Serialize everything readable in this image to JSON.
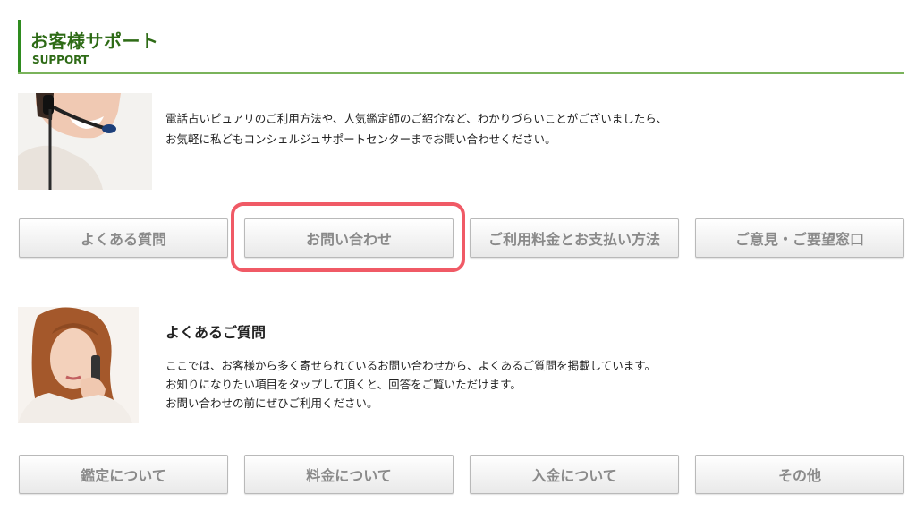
{
  "support": {
    "title": "お客様サポート",
    "subtitle": "SUPPORT",
    "intro_lines": [
      "電話占いピュアリのご利用方法や、人気鑑定師のご紹介など、わかりづらいことがございましたら、",
      "お気軽に私どもコンシェルジュサポートセンターまでお問い合わせください。"
    ],
    "buttons": [
      "よくある質問",
      "お問い合わせ",
      "ご利用料金とお支払い方法",
      "ご意見・ご要望窓口"
    ],
    "highlight_color": "#f05a66"
  },
  "faq": {
    "title": "よくあるご質問",
    "lines": [
      "ここでは、お客様から多く寄せられているお問い合わせから、よくあるご質問を掲載しています。",
      "お知りになりたい項目をタップして頂くと、回答をご覧いただけます。",
      "お問い合わせの前にぜひご利用ください。"
    ],
    "buttons": [
      "鑑定について",
      "料金について",
      "入金について",
      "その他"
    ]
  },
  "colors": {
    "accent_green": "#2e6b16",
    "button_text": "#8a8a8a"
  }
}
